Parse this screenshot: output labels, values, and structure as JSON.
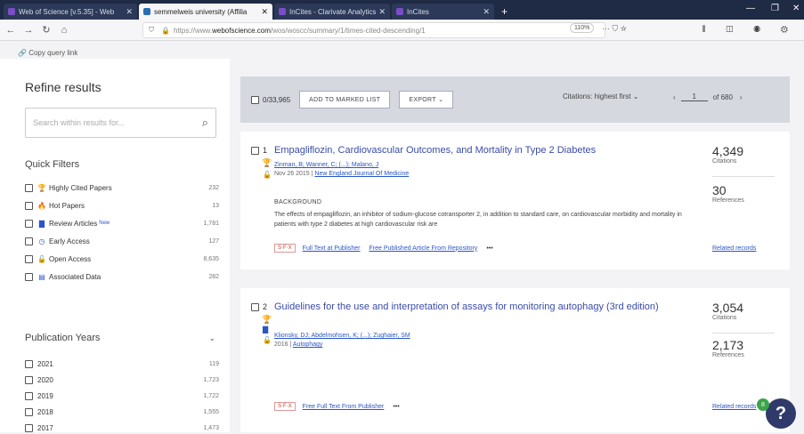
{
  "tabs": [
    {
      "label": "Web of Science [v.5.35] - Web"
    },
    {
      "label": "semmelweis university (Affilia"
    },
    {
      "label": "InCites - Clarivate Analytics"
    },
    {
      "label": "InCites"
    }
  ],
  "browser": {
    "url_prefix": "https://www.",
    "url_host": "webofscience.com",
    "url_path": "/wos/woscc/summary/1/times-cited-descending/1",
    "zoom": "110%"
  },
  "copy_query": "Copy query link",
  "sidebar": {
    "title": "Refine results",
    "search_placeholder": "Search within results for...",
    "quick_filters_title": "Quick Filters",
    "quick_filters": [
      {
        "label": "Highly Cited Papers",
        "count": "232",
        "icon": "trophy-icon",
        "glyph": "🏆",
        "color": "#d79b00"
      },
      {
        "label": "Hot Papers",
        "count": "13",
        "icon": "flame-icon",
        "glyph": "🔥",
        "color": "#c0392b"
      },
      {
        "label": "Review Articles",
        "count": "1,781",
        "icon": "document-icon",
        "glyph": "▇",
        "color": "#2a56c6",
        "badge": "New"
      },
      {
        "label": "Early Access",
        "count": "127",
        "icon": "clock-icon",
        "glyph": "◷",
        "color": "#2a56c6"
      },
      {
        "label": "Open Access",
        "count": "8,635",
        "icon": "open-lock-icon",
        "glyph": "🔓",
        "color": "#2a56c6"
      },
      {
        "label": "Associated Data",
        "count": "282",
        "icon": "database-icon",
        "glyph": "▤",
        "color": "#2a56c6"
      }
    ],
    "pub_years_title": "Publication Years",
    "pub_years": [
      {
        "label": "2021",
        "count": "119"
      },
      {
        "label": "2020",
        "count": "1,723"
      },
      {
        "label": "2019",
        "count": "1,722"
      },
      {
        "label": "2018",
        "count": "1,555"
      },
      {
        "label": "2017",
        "count": "1,473"
      }
    ]
  },
  "toolbar": {
    "selected": "0/33,965",
    "add_marked": "ADD TO MARKED LIST",
    "export": "EXPORT",
    "sort": "Citations: highest first",
    "page": "1",
    "of_pages": "of 680"
  },
  "results": [
    {
      "index": "1",
      "title": "Empagliflozin, Cardiovascular Outcomes, and Mortality in Type 2 Diabetes",
      "authors": "Zinman, B; Wanner, C; (...); Malano, J",
      "date": "Nov 26 2015",
      "journal": "New England Journal Of Medicine",
      "section": "BACKGROUND",
      "abstract": "The effects of empagliflozin, an inhibitor of sodium-glucose cotransporter 2, in addition to standard care, on cardiovascular morbidity and mortality in patients with type 2 diabetes at high cardiovascular risk are",
      "sfx": "S·F·X",
      "links": [
        "Full Text at Publisher",
        "Free Published Article From Repository"
      ],
      "dots": "•••",
      "citations": "4,349",
      "citations_label": "Citations",
      "references": "30",
      "references_label": "References",
      "related": "Related records"
    },
    {
      "index": "2",
      "title": "Guidelines for the use and interpretation of assays for monitoring autophagy (3rd edition)",
      "authors": "Klionsky, DJ; Abdelmohsen, K; (...); Zughaier, SM",
      "date": "2016",
      "journal": "Autophagy",
      "sfx": "S·F·X",
      "links": [
        "Free Full Text From Publisher"
      ],
      "dots": "•••",
      "citations": "3,054",
      "citations_label": "Citations",
      "references": "2,173",
      "references_label": "References",
      "related": "Related records"
    }
  ],
  "help": {
    "label": "?",
    "badge": "8"
  }
}
